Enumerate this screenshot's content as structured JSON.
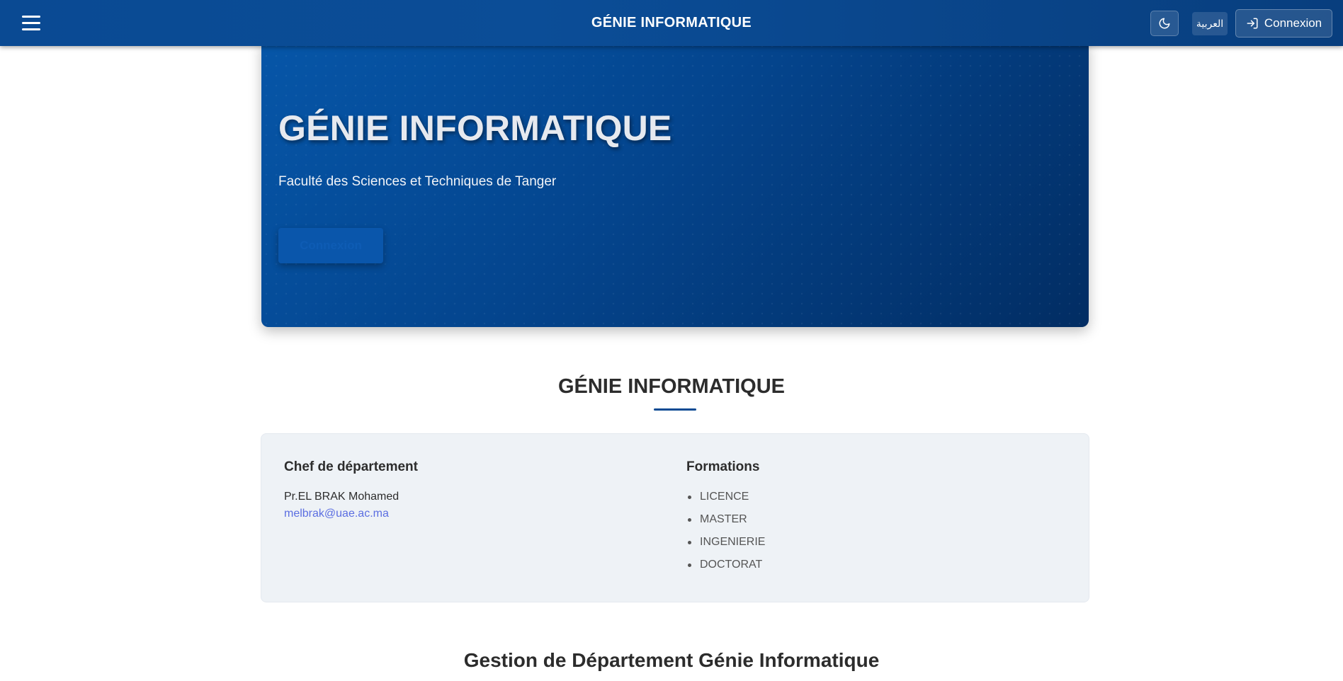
{
  "navbar": {
    "title": "GÉNIE INFORMATIQUE",
    "lang_label": "العربية",
    "login_label": "Connexion",
    "menu_icon": "hamburger-menu-icon",
    "theme_icon": "moon-icon",
    "login_icon": "sign-in-icon"
  },
  "hero": {
    "title": "GÉNIE INFORMATIQUE",
    "subtitle": "Faculté des Sciences et Techniques de Tanger",
    "button_label": "Connexion"
  },
  "section": {
    "title": "GÉNIE INFORMATIQUE"
  },
  "info": {
    "chef_heading": "Chef de département",
    "chef_name": "Pr.EL BRAK Mohamed",
    "chef_email": "melbrak@uae.ac.ma",
    "formations_heading": "Formations",
    "formations": [
      "LICENCE",
      "MASTER",
      "INGENIERIE",
      "DOCTORAT"
    ]
  },
  "gestion": {
    "title": "Gestion de Département Génie Informatique"
  },
  "colors": {
    "primary": "#0a4a93",
    "link": "#5b6ee1",
    "card_bg": "#eef2f6"
  }
}
